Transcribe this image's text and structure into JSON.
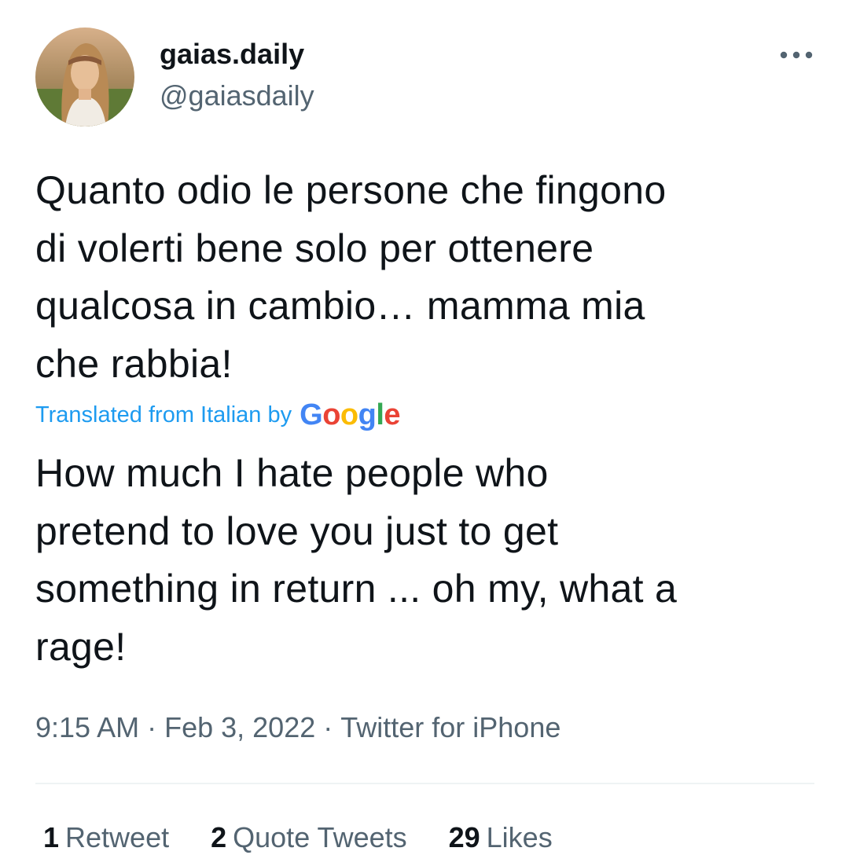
{
  "author": {
    "display_name": "gaias.daily",
    "handle": "@gaiasdaily",
    "avatar": "avatar"
  },
  "tweet": {
    "text": "Quanto odio le persone che fingono\ndi volerti bene solo per ottenere\nqualcosa in cambio… mamma mia\nche rabbia!",
    "translation_label": "Translated from Italian by",
    "translation_provider": "Google",
    "translated_text": "How much I hate people who\npretend to love you just to get\nsomething in return ... oh my, what a\nrage!",
    "time": "9:15 AM",
    "date": "Feb 3, 2022",
    "source": "Twitter for iPhone",
    "separator": "·"
  },
  "stats": {
    "retweets_count": "1",
    "retweets_label": "Retweet",
    "quotes_count": "2",
    "quotes_label": "Quote Tweets",
    "likes_count": "29",
    "likes_label": "Likes"
  },
  "icons": {
    "more": "more-dots-icon"
  },
  "colors": {
    "link": "#1d9bf0",
    "secondary_text": "#536471",
    "primary_text": "#0f1419",
    "divider": "#eff3f4"
  }
}
